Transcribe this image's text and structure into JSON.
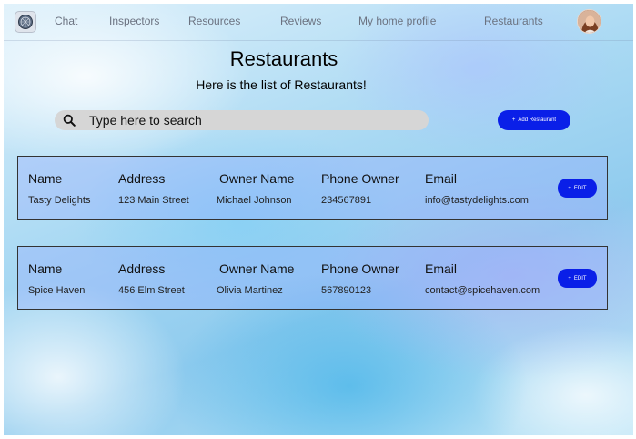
{
  "nav": {
    "items": [
      {
        "name": "nav-link-chat",
        "label": "Chat"
      },
      {
        "name": "nav-link-inspectors",
        "label": "Inspectors"
      },
      {
        "name": "nav-link-resources",
        "label": "Resources"
      },
      {
        "name": "nav-link-reviews",
        "label": "Reviews"
      },
      {
        "name": "nav-link-my-home-profile",
        "label": "My home profile"
      },
      {
        "name": "nav-link-restaurants",
        "label": "Restaurants"
      }
    ],
    "logo_icon": "globe-logo-icon",
    "avatar_icon": "user-avatar"
  },
  "header": {
    "title": "Restaurants",
    "subtitle": "Here is the list of Restaurants!"
  },
  "search": {
    "placeholder": "Type here to search",
    "icon": "search-icon"
  },
  "add_button": {
    "icon": "+",
    "label": "Add Restaurant"
  },
  "columns": [
    "Name",
    "Address",
    "Owner Name",
    "Phone Owner",
    "Email"
  ],
  "restaurants": [
    {
      "name": "Tasty Delights",
      "address": "123 Main Street",
      "owner_name": "Michael Johnson",
      "phone_owner": "234567891",
      "email": "info@tastydelights.com"
    },
    {
      "name": "Spice Haven",
      "address": "456 Elm Street",
      "owner_name": "Olivia Martinez",
      "phone_owner": "567890123",
      "email": "contact@spicehaven.com"
    }
  ],
  "edit_button": {
    "icon": "+",
    "label": "EDIT"
  },
  "colors": {
    "button_blue": "#0a1fe8",
    "search_bg": "#d6d6d6",
    "nav_text": "#6b7280"
  }
}
